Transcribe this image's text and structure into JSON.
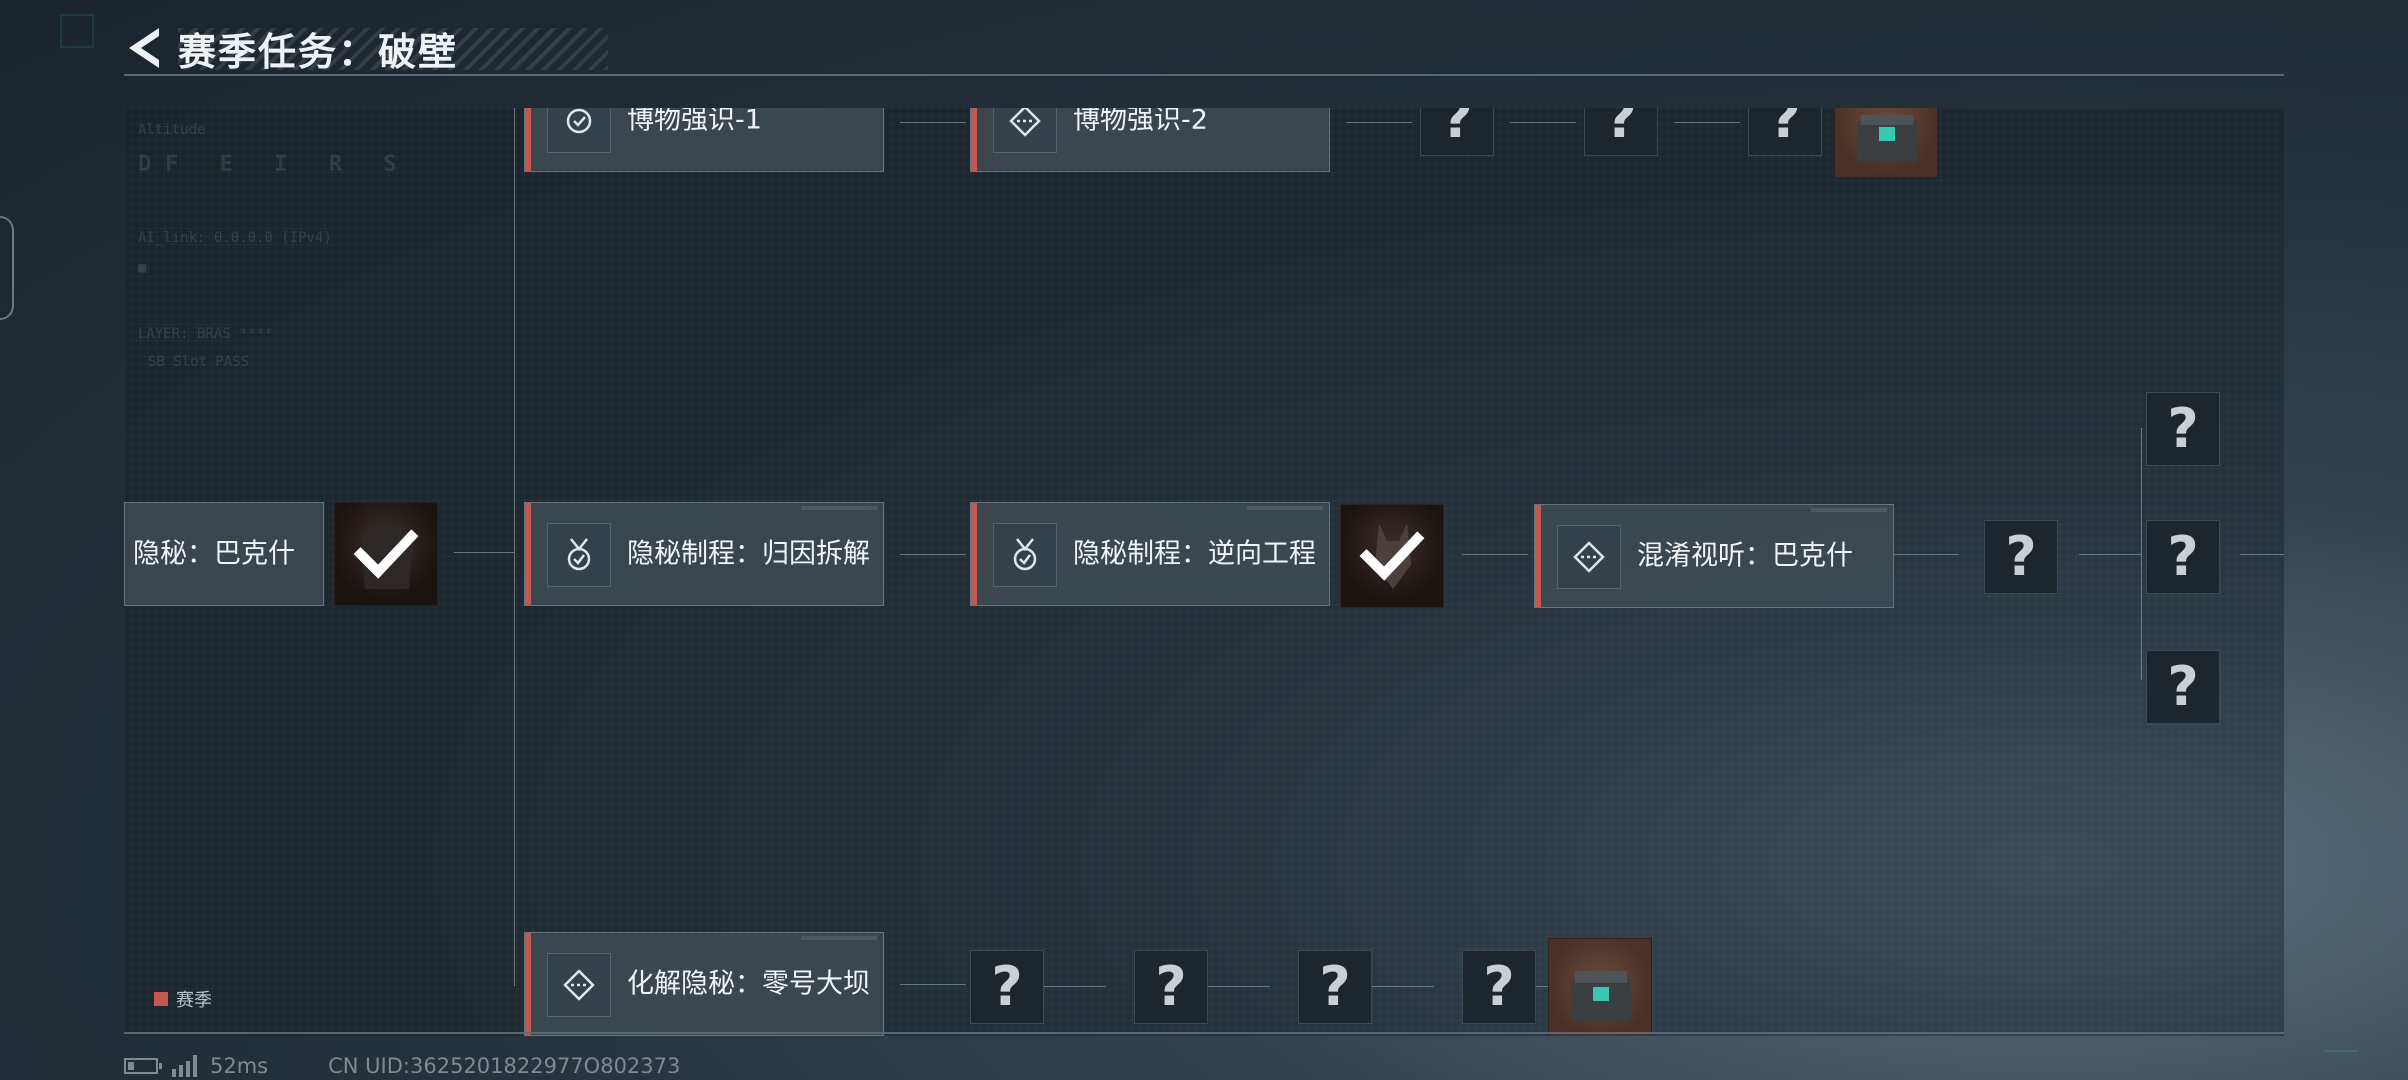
{
  "header": {
    "title": "赛季任务：破壁"
  },
  "deco": {
    "line1": "Altitude",
    "line2": "DF  E  I  R  S",
    "line3": "AI_link: 0.0.0.0 (IPv4)",
    "line4": "■",
    "line5": "LAYER: BRAS ****",
    "line6": "SB      Slot PASS"
  },
  "nodes": {
    "top_left_label": "博物强识-1",
    "top_mid_label": "博物强识-2",
    "left_label": "隐秘：巴克什",
    "mid1_label": "隐秘制程：归因拆解",
    "mid2_label": "隐秘制程：逆向工程",
    "mid3_label": "混淆视听：巴克什",
    "bottom_label": "化解隐秘：零号大坝"
  },
  "mystery_symbol": "?",
  "legend": {
    "label": "赛季",
    "color": "#c4574f"
  },
  "status": {
    "latency": "52ms",
    "uid": "CN UID:3625201822977O802373"
  },
  "colors": {
    "accent": "#c4574f",
    "background": "#24303a"
  }
}
